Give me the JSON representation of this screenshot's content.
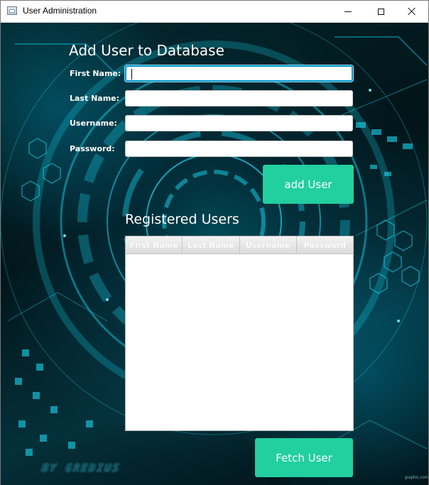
{
  "window": {
    "title": "User Administration"
  },
  "form": {
    "heading": "Add User to Database",
    "fields": [
      {
        "label": "First Name:",
        "value": "",
        "placeholder": ""
      },
      {
        "label": "Last Name:",
        "value": "",
        "placeholder": ""
      },
      {
        "label": "Username:",
        "value": "",
        "placeholder": ""
      },
      {
        "label": "Password:",
        "value": "",
        "placeholder": ""
      }
    ],
    "add_button": "add User"
  },
  "users": {
    "heading": "Registered Users",
    "columns": [
      "First Name",
      "Last Name",
      "Username",
      "Password"
    ],
    "rows": [],
    "fetch_button": "Fetch User"
  },
  "background": {
    "signature": "BY GREDIUS",
    "watermark": "graphic.com"
  },
  "colors": {
    "accent_button": "#21cf9f",
    "focus_ring": "#0096c9",
    "background_cyan": "#00d4f0"
  }
}
